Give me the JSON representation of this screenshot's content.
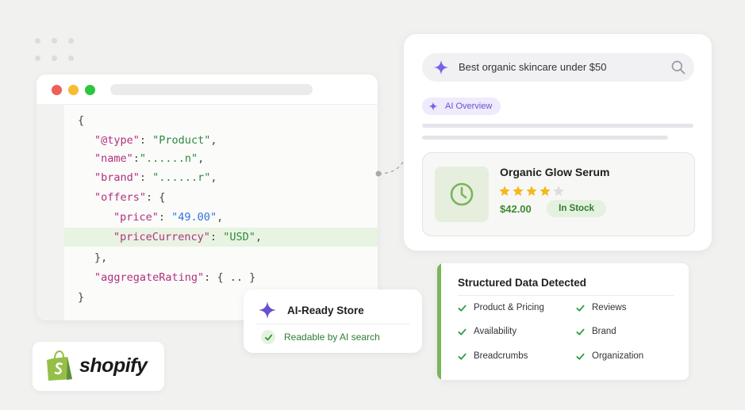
{
  "code_window": {
    "lines": [
      "{",
      "\"@type\": \"Product\",",
      "\"name\":\"......n\",",
      "\"brand\": \"......r\",",
      "\"offers\": {",
      "\"price\": \"49.00\",",
      "\"priceCurrency\": \"USD\",",
      "},",
      "\"aggregateRating\": { .. }",
      "}"
    ],
    "tokens": {
      "open_brace": "{",
      "type_key": "\"@type\"",
      "type_val": "\"Product\"",
      "name_key": "\"name\"",
      "name_val": "\"......n\"",
      "brand_key": "\"brand\"",
      "brand_val": "\"......r\"",
      "offers_key": "\"offers\"",
      "price_key": "\"price\"",
      "price_val": "\"49.00\"",
      "currency_key": "\"priceCurrency\"",
      "currency_val": "\"USD\"",
      "offers_close": "},",
      "rating_key": "\"aggregateRating\"",
      "rating_val": "{ .. }",
      "close_brace": "}"
    }
  },
  "search": {
    "query": "Best organic skincare under $50",
    "ai_overview_label": "AI Overview"
  },
  "product": {
    "name": "Organic Glow Serum",
    "rating": 4,
    "rating_max": 5,
    "price": "$42.00",
    "stock": "In Stock",
    "thumb_icon": "clock-icon"
  },
  "ai_ready": {
    "title": "AI-Ready Store",
    "subtitle": "Readable by AI search"
  },
  "structured_data": {
    "title": "Structured Data Detected",
    "items": [
      "Product & Pricing",
      "Reviews",
      "Availability",
      "Brand",
      "Breadcrumbs",
      "Organization"
    ]
  },
  "brand": {
    "wordmark": "shopify"
  },
  "colors": {
    "accent_purple": "#6a4fcf",
    "accent_green": "#7ab55c",
    "star": "#f4b81c",
    "highlight_row": "#e8f3e2"
  }
}
